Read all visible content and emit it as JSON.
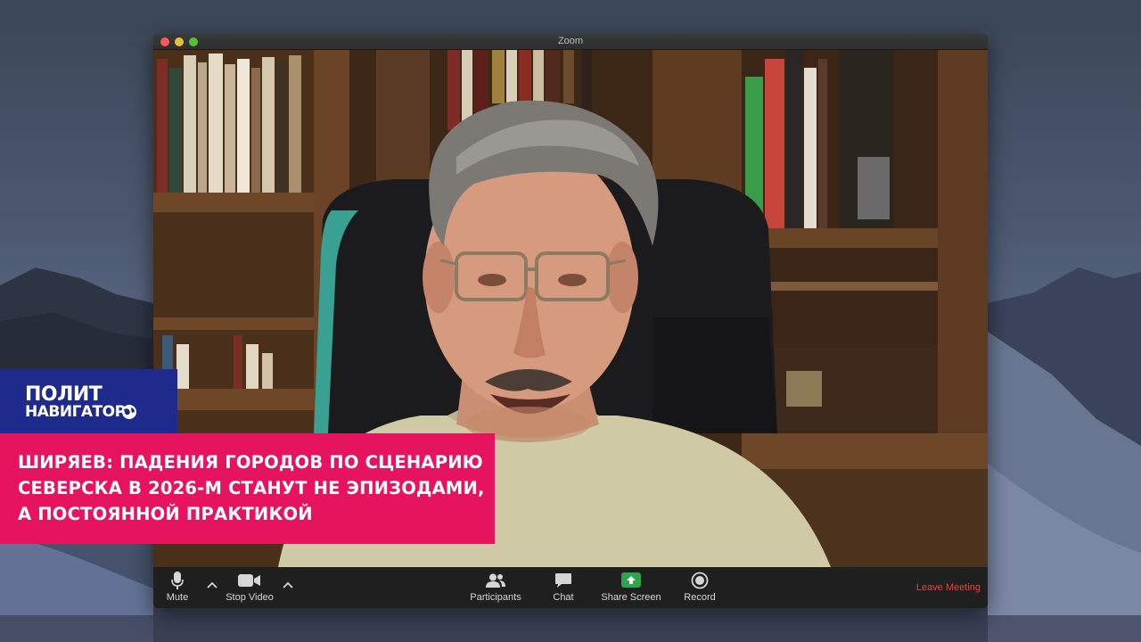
{
  "window": {
    "title": "Zoom",
    "traffic_lights": [
      "close",
      "minimize",
      "maximize"
    ]
  },
  "toolbar": {
    "mute_label": "Mute",
    "stop_video_label": "Stop Video",
    "participants_label": "Participants",
    "chat_label": "Chat",
    "share_screen_label": "Share Screen",
    "record_label": "Record",
    "leave_label": "Leave Meeting",
    "share_color": "#2da44e",
    "leave_color": "#e0463b"
  },
  "overlay": {
    "logo_line1": "ПОЛИТ",
    "logo_line2": "НАВИГАТОР",
    "logo_color": "#1e2a8c",
    "headline_color": "#e6145f",
    "headline_lines": [
      "ШИРЯЕВ: ПАДЕНИЯ ГОРОДОВ ПО СЦЕНАРИЮ",
      "СЕВЕРСКА В 2026-М СТАНУТ НЕ ЭПИЗОДАМИ,",
      "А ПОСТОЯННОЙ ПРАКТИКОЙ"
    ]
  },
  "icons": {
    "mute": "microphone-icon",
    "stop_video": "video-camera-icon",
    "participants": "participants-icon",
    "chat": "chat-bubble-icon",
    "share_screen": "share-screen-icon",
    "record": "record-icon",
    "logo": "globe-icon"
  }
}
